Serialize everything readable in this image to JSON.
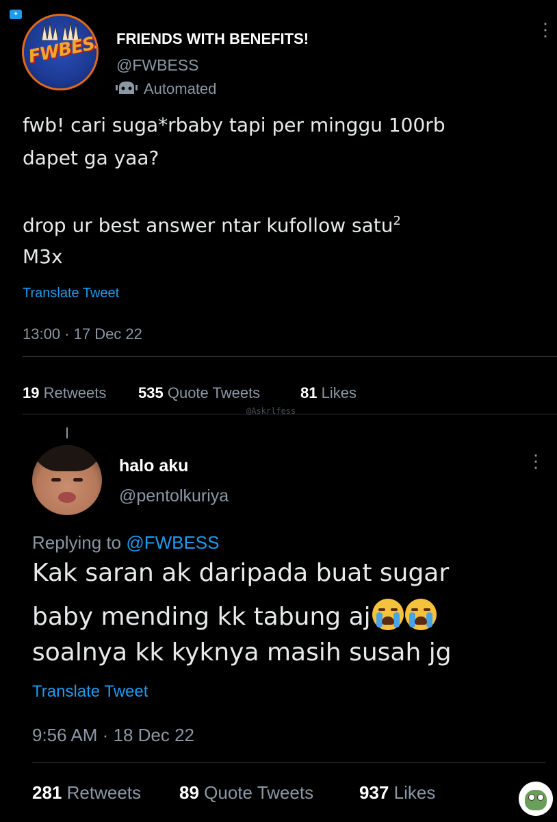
{
  "first_tweet": {
    "display_name": "FRIENDS WITH BENEFITS!",
    "handle": "@FWBESS",
    "automated_label": "Automated",
    "avatar_logo_text": "FWBESS",
    "text_line1": "fwb! cari suga*rbaby tapi per minggu 100rb",
    "text_line2": "dapet ga yaa?",
    "text_line3": "drop ur best answer ntar kufollow satu",
    "text_line3_sup": "2",
    "text_line4": "M3x",
    "translate_label": "Translate Tweet",
    "timestamp": "13:00 · 17 Dec 22",
    "stats": {
      "retweets_count": "19",
      "retweets_label": "Retweets",
      "quotes_count": "535",
      "quotes_label": "Quote Tweets",
      "likes_count": "81",
      "likes_label": "Likes"
    }
  },
  "watermark": "@Askrlfess",
  "reply_tweet": {
    "display_name": "halo aku",
    "handle": "@pentolkuriya",
    "replying_to_prefix": "Replying to",
    "replying_to_handle": "@FWBESS",
    "text_line1": "Kak saran ak daripada buat sugar",
    "text_line2": "baby mending kk tabung aj",
    "text_line3": "soalnya kk kyknya masih susah jg",
    "emoji": "loudly-crying-face",
    "translate_label": "Translate Tweet",
    "timestamp": "9:56 AM · 18 Dec 22",
    "stats": {
      "retweets_count": "281",
      "retweets_label": "Retweets",
      "quotes_count": "89",
      "quotes_label": "Quote Tweets",
      "likes_count": "937",
      "likes_label": "Likes"
    }
  },
  "colors": {
    "background": "#000000",
    "link": "#1d9bf0",
    "muted": "#8b98a5",
    "text": "#e7e9ea"
  }
}
